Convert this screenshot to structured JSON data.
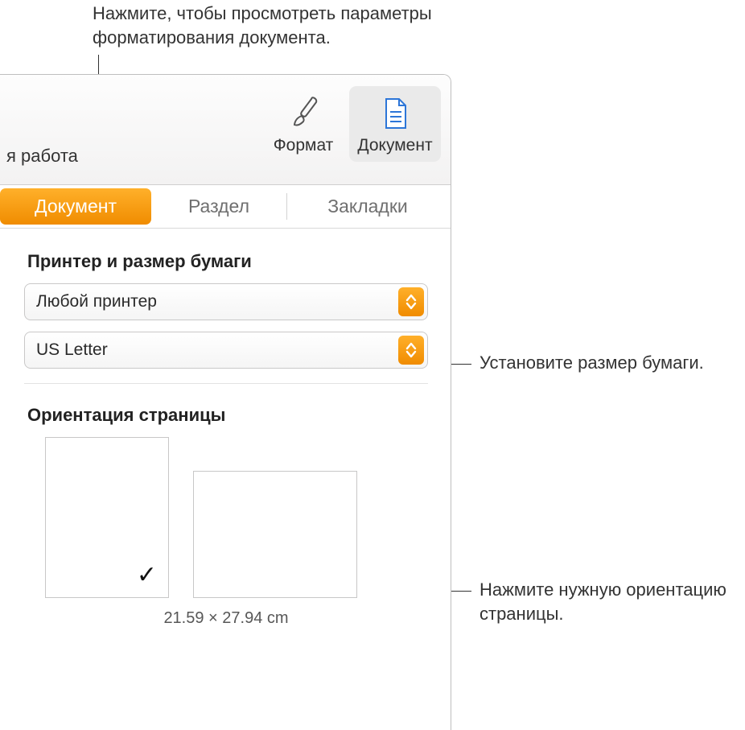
{
  "callouts": {
    "top": "Нажмите, чтобы просмотреть параметры форматирования документа.",
    "paper": "Установите размер бумаги.",
    "orient": "Нажмите нужную ориентацию страницы."
  },
  "toolbar": {
    "left_fragment": "я работа",
    "format_label": "Формат",
    "document_label": "Документ"
  },
  "tabs": {
    "document": "Документ",
    "section": "Раздел",
    "bookmarks": "Закладки"
  },
  "printer_section": {
    "title": "Принтер и размер бумаги",
    "printer_value": "Любой принтер",
    "paper_value": "US Letter"
  },
  "orientation_section": {
    "title": "Ориентация страницы",
    "dimensions": "21.59 × 27.94 cm"
  }
}
